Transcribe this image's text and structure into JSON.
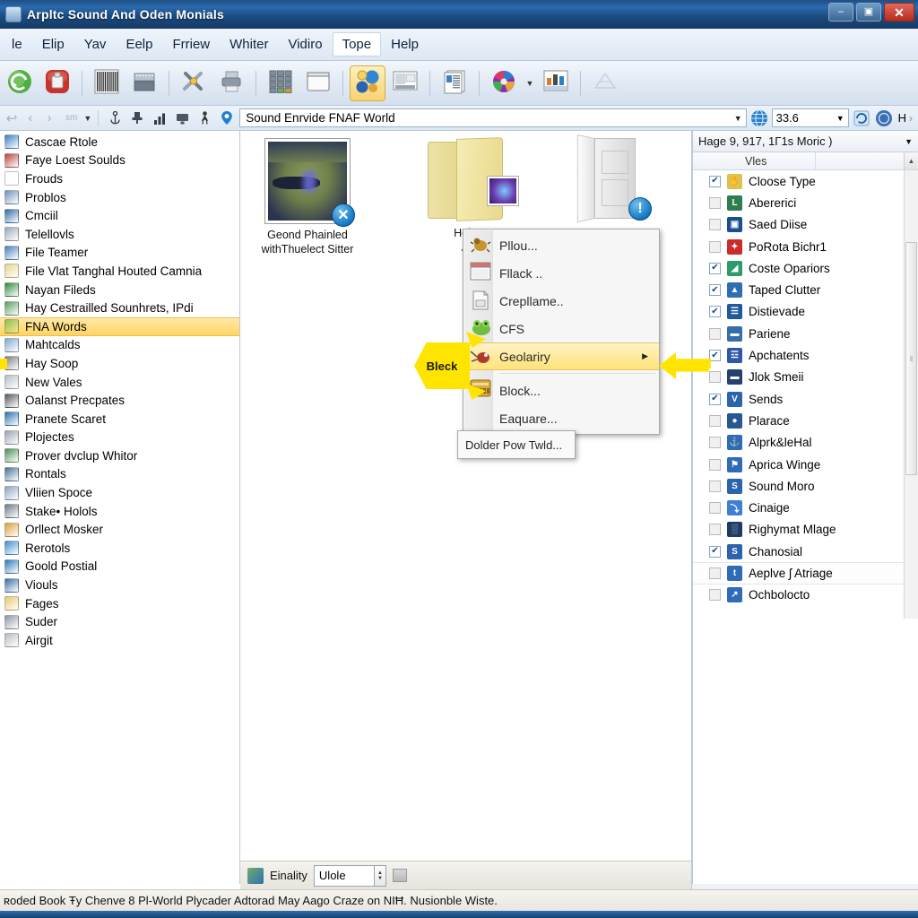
{
  "window": {
    "title": "Arpltc Sound And Oden Monials",
    "buttons": {
      "minimize": "–",
      "maximize": "▣",
      "close": "✕"
    }
  },
  "menubar": {
    "items": [
      {
        "label": "le",
        "active": false
      },
      {
        "label": "Elip",
        "active": false
      },
      {
        "label": "Yav",
        "active": false
      },
      {
        "label": "Eelp",
        "active": false
      },
      {
        "label": "Frriew",
        "active": false
      },
      {
        "label": "Whiter",
        "active": false
      },
      {
        "label": "Vidiro",
        "active": false
      },
      {
        "label": "Tope",
        "active": true
      },
      {
        "label": "Help",
        "active": false
      }
    ]
  },
  "toolbar": {
    "buttons": [
      {
        "name": "refresh-green-icon",
        "glyph": "⟳"
      },
      {
        "name": "stop-red-icon",
        "glyph": "■"
      },
      {
        "name": "barcode-icon",
        "glyph": "‖"
      },
      {
        "name": "film-strip-icon",
        "glyph": "▤"
      },
      {
        "name": "tools-cross-icon",
        "glyph": "✖"
      },
      {
        "name": "printer-icon",
        "glyph": "⎙"
      },
      {
        "name": "grid-view-icon",
        "glyph": "⬚"
      },
      {
        "name": "window-icon",
        "glyph": "▭"
      },
      {
        "name": "globe-group-icon",
        "glyph": "●",
        "highlighted": true
      },
      {
        "name": "monitor-icon",
        "glyph": "▣"
      },
      {
        "name": "document-list-icon",
        "glyph": "☰"
      },
      {
        "name": "palette-icon",
        "glyph": "●"
      },
      {
        "name": "chart-icon",
        "glyph": "▥"
      },
      {
        "name": "ghost-icon",
        "glyph": "◇"
      }
    ]
  },
  "addressbar": {
    "back": "↩",
    "prev": "‹",
    "next": "›",
    "history_label": "sm",
    "history_caret": "▼",
    "value": "Sound Enrvide FNAF World",
    "dropdown_caret": "▼",
    "zoom_value": "33.6",
    "zoom_caret": "▼",
    "right_letter": "H",
    "right_caret": "›",
    "icons": [
      "anchor-icon",
      "plug-icon",
      "bars-chart-icon",
      "monitor-small-icon",
      "person-icon",
      "location-pin-icon"
    ]
  },
  "left_panel": {
    "items": [
      {
        "label": "Cascae Rtole",
        "color": "#3d7fc1",
        "selected": false
      },
      {
        "label": "Faye Loest Soulds",
        "color": "#b8443a",
        "selected": false
      },
      {
        "label": "Frouds",
        "color": "#e8c košt",
        "selected": false
      },
      {
        "label": "Problos",
        "color": "#7092b8",
        "selected": false
      },
      {
        "label": "Cmciil",
        "color": "#2f6ba8",
        "selected": false
      },
      {
        "label": "Telellovls",
        "color": "#9aa8b5",
        "selected": false
      },
      {
        "label": "File Teamer",
        "color": "#4a7fbd",
        "selected": false
      },
      {
        "label": "File Vlat Tanghal Houted Camnia",
        "color": "#e6d58a",
        "selected": false
      },
      {
        "label": "Nayan Fileds",
        "color": "#2e8b3d",
        "selected": false
      },
      {
        "label": "Hay Cestrailled Sounhrets, IPdi",
        "color": "#5b9c5b",
        "selected": false
      },
      {
        "label": "FNA Words",
        "color": "#8fbf4a",
        "selected": true
      },
      {
        "label": "Mahtcalds",
        "color": "#7fa9cf",
        "selected": false
      },
      {
        "label": "Hay Soop",
        "color": "#7d7d7d",
        "selected": false
      },
      {
        "label": "New Vales",
        "color": "#b5bec8",
        "selected": false
      },
      {
        "label": "Oalanst Precpates",
        "color": "#55585d",
        "selected": false
      },
      {
        "label": "Pranete Scaret",
        "color": "#2d6fb0",
        "selected": false
      },
      {
        "label": "Plojectes",
        "color": "#97a3ae",
        "selected": false
      },
      {
        "label": "Prover dvclup Whitor",
        "color": "#4d8f55",
        "selected": false
      },
      {
        "label": "Rontals",
        "color": "#4a7096",
        "selected": false
      },
      {
        "label": "Vliien Spoce",
        "color": "#8aa6c2",
        "selected": false
      },
      {
        "label": "Stake• Holols",
        "color": "#6d7a86",
        "selected": false
      },
      {
        "label": "Orllect Mosker",
        "color": "#d9a03c",
        "selected": false
      },
      {
        "label": "Rerotols",
        "color": "#3f8ed0",
        "selected": false
      },
      {
        "label": "Goold Postial",
        "color": "#2f79bd",
        "selected": false
      },
      {
        "label": "Viouls",
        "color": "#3a6ea8",
        "selected": false
      },
      {
        "label": "Fages",
        "color": "#e8c96a",
        "selected": false
      },
      {
        "label": "Suder",
        "color": "#8d98a3",
        "selected": false
      },
      {
        "label": "Airgit",
        "color": "#b9bec4",
        "selected": false
      }
    ]
  },
  "center_panel": {
    "items": [
      {
        "name": "image-thumb",
        "caption_line1": "Geond Phainled",
        "caption_line2": "withThuelect Sitter",
        "badge": "✕"
      },
      {
        "name": "folder-thumb",
        "caption_line1": "Holtı",
        "caption_line2": "A",
        "badge": ""
      },
      {
        "name": "door-thumb",
        "caption_line1": "",
        "caption_line2": "",
        "badge": "!"
      }
    ],
    "hscroll": {
      "left_arrow": "◀",
      "right_arrow": "▶",
      "grip": "III"
    }
  },
  "context_menu": {
    "items": [
      {
        "label": "Pllou...",
        "icon": "bug-icon",
        "highlighted": false,
        "submenu": false
      },
      {
        "label": "Fllack ..",
        "icon": "window-icon",
        "highlighted": false,
        "submenu": false
      },
      {
        "label": "Crepllame..",
        "icon": "printer-icon",
        "highlighted": false,
        "submenu": false
      },
      {
        "label": "CFS",
        "icon": "frog-icon",
        "highlighted": false,
        "submenu": false
      },
      {
        "label": "Geolariry",
        "icon": "mouse-icon",
        "highlighted": true,
        "submenu": true
      },
      {
        "label": "Block...",
        "icon": "card-icon",
        "highlighted": false,
        "submenu": false
      },
      {
        "label": "Eaquare...",
        "icon": "",
        "highlighted": false,
        "submenu": false
      }
    ],
    "submenu_label": "Dolder Pow Twld...",
    "arrow_glyph": "▶"
  },
  "callouts": {
    "left_label": "Bleck",
    "accent_color": "#ffe400"
  },
  "right_panel": {
    "header": "Hage 9, 917, 1Γ1s Moric )",
    "header_caret": "▼",
    "column_header": "Vles",
    "scroll_up": "▲",
    "scrollbar_grip": "‖",
    "items": [
      {
        "label": "Cloose Type",
        "checked": true,
        "color": "#e0c24a",
        "glyph": "✋",
        "hi": false
      },
      {
        "label": "Abererici",
        "checked": false,
        "color": "#2f7d4f",
        "glyph": "L",
        "hi": false
      },
      {
        "label": "Saed Diise",
        "checked": false,
        "color": "#1b4e8c",
        "glyph": "▣",
        "hi": false
      },
      {
        "label": "PoRota Bichr1",
        "checked": false,
        "color": "#cc2b2b",
        "glyph": "✦",
        "hi": false
      },
      {
        "label": "Coste Opariors",
        "checked": true,
        "color": "#2d9c6a",
        "glyph": "◢",
        "hi": false
      },
      {
        "label": "Taped Clutter",
        "checked": true,
        "color": "#2d6fb0",
        "glyph": "▲",
        "hi": false
      },
      {
        "label": "Distievade",
        "checked": true,
        "color": "#1d5a9e",
        "glyph": "☰",
        "hi": false
      },
      {
        "label": "Pariene",
        "checked": false,
        "color": "#356ea8",
        "glyph": "▬",
        "hi": false
      },
      {
        "label": "Apchatents",
        "checked": true,
        "color": "#3157a8",
        "glyph": "☲",
        "hi": false
      },
      {
        "label": "Jlok Smeii",
        "checked": false,
        "color": "#26416b",
        "glyph": "▬",
        "hi": false
      },
      {
        "label": "Sends",
        "checked": true,
        "color": "#2b63ac",
        "glyph": "V",
        "hi": false
      },
      {
        "label": "Plarace",
        "checked": false,
        "color": "#27598f",
        "glyph": "●",
        "hi": false
      },
      {
        "label": "Alprk&leHal",
        "checked": false,
        "color": "#2f6cb5",
        "glyph": "⚓",
        "hi": false
      },
      {
        "label": "Aprica Winge",
        "checked": false,
        "color": "#2f6cb5",
        "glyph": "⚑",
        "hi": false
      },
      {
        "label": "Sound Moro",
        "checked": false,
        "color": "#2b63ac",
        "glyph": "S",
        "hi": false
      },
      {
        "label": "Cinaige",
        "checked": false,
        "color": "#3f7fd0",
        "glyph": "⤵",
        "hi": false
      },
      {
        "label": "Righymat Mlage",
        "checked": false,
        "color": "#1e3b63",
        "glyph": "░",
        "hi": false
      },
      {
        "label": "Chanosial",
        "checked": true,
        "color": "#2b63ac",
        "glyph": "S",
        "hi": false
      },
      {
        "label": "Aeplve ʃ Atriage",
        "checked": false,
        "color": "#2f6cb5",
        "glyph": "t",
        "hi": true
      },
      {
        "label": "Ochbolocto",
        "checked": false,
        "color": "#2f6cb5",
        "glyph": "↗",
        "hi": false
      }
    ]
  },
  "bottom_bar": {
    "label": "Einality",
    "field_value": "Ulole",
    "spin_up": "▲",
    "spin_down": "▼"
  },
  "status_bar": {
    "text": "ʀoded Book Ŧy Chenve 8 Pl-World Plycader Adtorad May Aago Craze on NIĦ. Nusionble Wiste."
  }
}
